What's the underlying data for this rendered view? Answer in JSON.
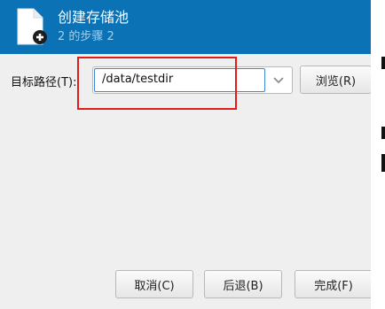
{
  "header": {
    "title": "创建存储池",
    "subtitle": "2 的步骤 2",
    "icon": "new-storage-pool-icon",
    "background_color": "#0a72b5"
  },
  "form": {
    "target_path_label": "目标路径(T):",
    "target_path_value": "/data/testdir",
    "browse_label": "浏览(R)"
  },
  "footer": {
    "cancel_label": "取消(C)",
    "back_label": "后退(B)",
    "finish_label": "完成(F)"
  },
  "annotation": {
    "highlight_color": "#e21b1b"
  }
}
